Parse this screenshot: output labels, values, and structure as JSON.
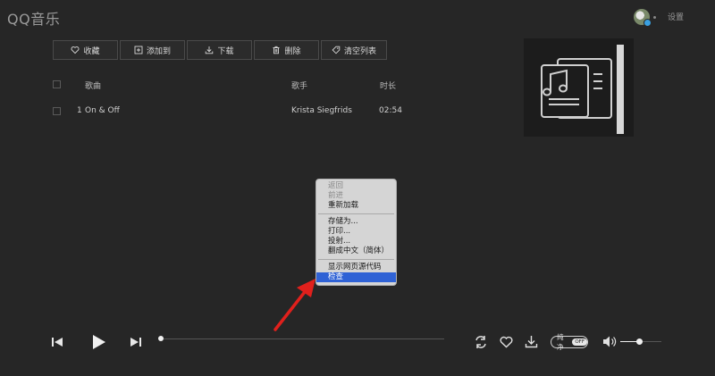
{
  "app": {
    "logo": "QQ音乐",
    "settings_label": "设置"
  },
  "toolbar": {
    "favorite": "收藏",
    "add_to": "添加到",
    "download": "下载",
    "delete": "删除",
    "clear_list": "清空列表"
  },
  "table": {
    "headers": {
      "song": "歌曲",
      "artist": "歌手",
      "duration": "时长"
    },
    "rows": [
      {
        "index": "1",
        "title": "On & Off",
        "artist": "Krista Siegfrids",
        "duration": "02:54"
      }
    ]
  },
  "context_menu": {
    "items": [
      {
        "label": "返回",
        "state": "disabled"
      },
      {
        "label": "前进",
        "state": "disabled"
      },
      {
        "label": "重新加载",
        "state": "enabled"
      },
      {
        "label": "存储为...",
        "state": "enabled"
      },
      {
        "label": "打印...",
        "state": "enabled"
      },
      {
        "label": "投射...",
        "state": "enabled"
      },
      {
        "label": "翻成中文（简体）",
        "state": "enabled"
      },
      {
        "label": "显示网页源代码",
        "state": "enabled"
      },
      {
        "label": "检查",
        "state": "highlighted"
      }
    ]
  },
  "player": {
    "progress": 0,
    "volume": 0.45,
    "quality_label": "纯净",
    "quality_state": "OFF"
  },
  "colors": {
    "background": "#262626",
    "menu_highlight": "#2f62d5",
    "annotation_arrow": "#e0201c"
  },
  "icons": {
    "toolbar": [
      "heart-icon",
      "plus-square-icon",
      "download-icon",
      "trash-icon",
      "tag-icon"
    ],
    "player": [
      "previous-icon",
      "play-icon",
      "next-icon",
      "repeat-icon",
      "heart-icon",
      "download-icon",
      "volume-icon"
    ],
    "cover": "music-document-icon"
  }
}
